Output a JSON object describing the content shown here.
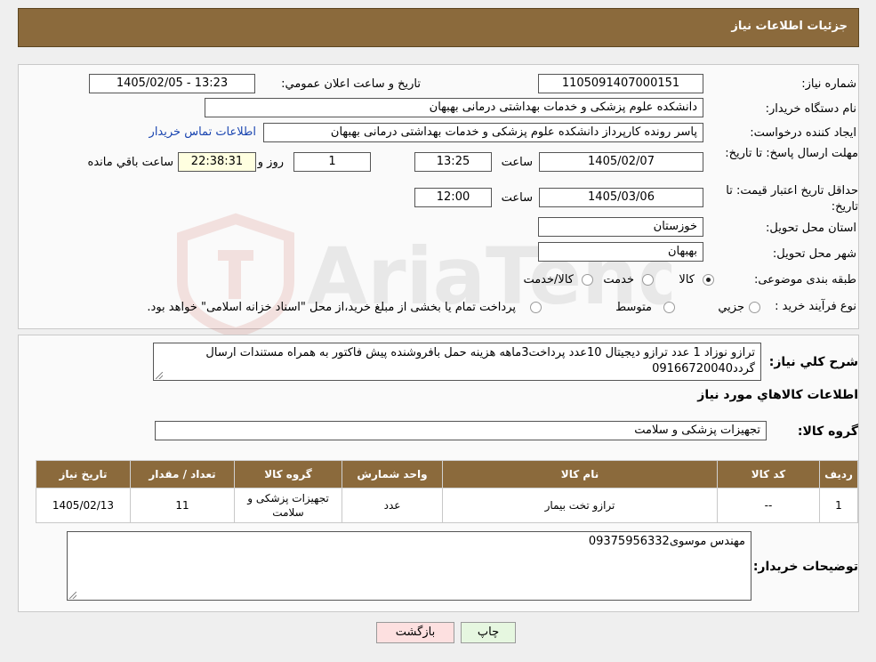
{
  "header": {
    "title": "جزئیات اطلاعات نیاز"
  },
  "form": {
    "need_number_label": "شماره نیاز:",
    "need_number": "1105091407000151",
    "announce_label": "تاریخ و ساعت اعلان عمومي:",
    "announce_value": "1405/02/05 - 13:23",
    "buyer_org_label": "نام دستگاه خريدار:",
    "buyer_org": "دانشکده علوم پزشکی و خدمات بهداشتی  درمانی بهبهان",
    "requester_label": "ايجاد کننده درخواست:",
    "requester": "پاسر رونده کارپرداز دانشکده علوم پزشکی و خدمات بهداشتی  درمانی بهبهان",
    "contact_link": "اطلاعات تماس خريدار",
    "reply_deadline_label": "مهلت ارسال پاسخ: تا تاريخ:",
    "reply_date": "1405/02/07",
    "time_label": "ساعت",
    "reply_time": "13:25",
    "days_value": "1",
    "days_label": "روز و",
    "remaining_value": "22:38:31",
    "remaining_label": "ساعت باقي مانده",
    "price_validity_label": "حداقل تاريخ اعتبار قيمت: تا تاريخ:",
    "price_date": "1405/03/06",
    "price_time": "12:00",
    "province_label": "استان محل تحويل:",
    "province": "خوزستان",
    "city_label": "شهر محل تحويل:",
    "city": "بهبهان",
    "category_label": "طبقه بندی موضوعی:",
    "category_options": [
      "کالا",
      "خدمت",
      "کالا/خدمت"
    ],
    "category_selected": "کالا",
    "process_label": "نوع فرآيند خريد :",
    "process_options": [
      "جزيي",
      "متوسط"
    ],
    "process_note": "پرداخت تمام يا بخشی از مبلغ خريد،از محل \"اسناد خزانه اسلامی\" خواهد بود."
  },
  "description": {
    "label": "شرح کلي نياز:",
    "text": "ترازو نوزاد 1 عدد ترازو دیجیتال 10عدد پرداخت3ماهه هزینه حمل بافروشنده پیش فاکتور به همراه مستندات ارسال گردد09166720040"
  },
  "goods": {
    "section_title": "اطلاعات کالاهاي مورد نياز",
    "group_label": "گروه کالا:",
    "group_value": "تجهیزات پزشکی و سلامت",
    "columns": [
      "رديف",
      "کد کالا",
      "نام کالا",
      "واحد شمارش",
      "گروه کالا",
      "تعداد / مقدار",
      "تاريخ نياز"
    ],
    "rows": [
      {
        "index": "1",
        "code": "--",
        "name": "ترازو تخت بیمار",
        "unit": "عدد",
        "group": "تجهیزات پزشکی و سلامت",
        "qty": "11",
        "date": "1405/02/13"
      }
    ]
  },
  "notes": {
    "label": "توضيحات خريدار:",
    "text": "مهندس موسوی09375956332"
  },
  "buttons": {
    "print": "چاپ",
    "back": "بازگشت"
  },
  "colors": {
    "header": "#8b6a3c",
    "print_button": "#e6f7e0",
    "back_button": "#fde0e0"
  }
}
